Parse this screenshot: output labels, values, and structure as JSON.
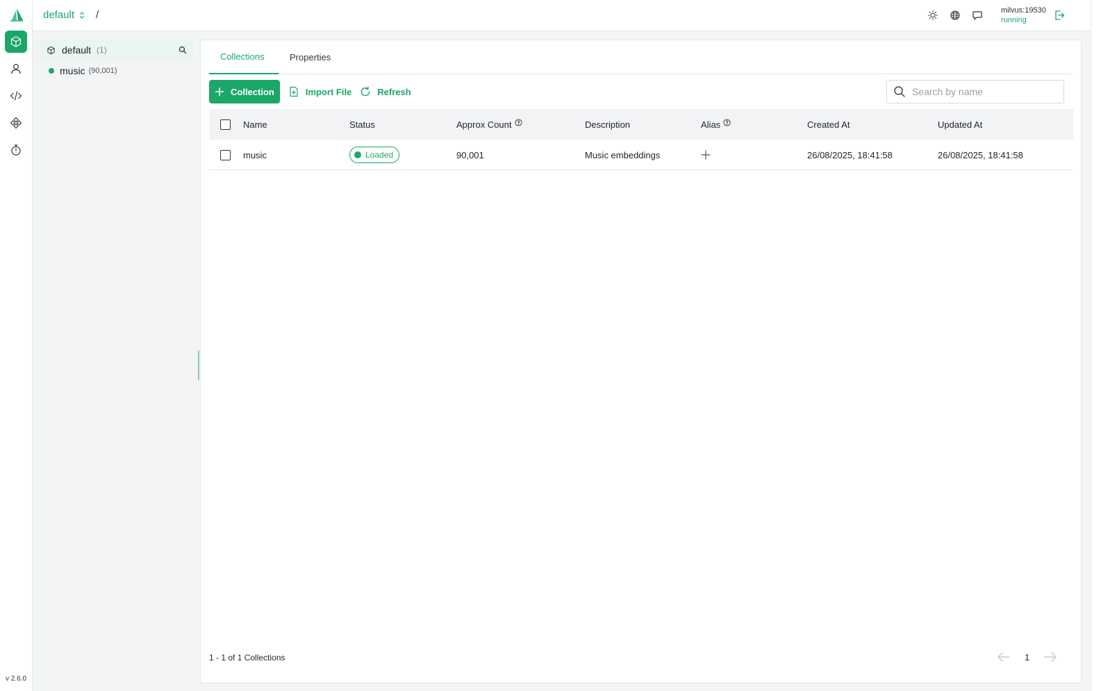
{
  "app": {
    "version": "v 2.6.0",
    "accent_color": "#1aa768"
  },
  "rail": {
    "items": [
      {
        "name": "databases",
        "icon": "cube-icon",
        "active": true
      },
      {
        "name": "users",
        "icon": "user-icon",
        "active": false
      },
      {
        "name": "code",
        "icon": "code-icon",
        "active": false
      },
      {
        "name": "system",
        "icon": "nodes-icon",
        "active": false
      },
      {
        "name": "tasks",
        "icon": "stopwatch-icon",
        "active": false
      }
    ]
  },
  "topbar": {
    "database": "default",
    "separator": "/",
    "connection_address": "milvus:19530",
    "connection_status": "running"
  },
  "tree": {
    "database_label": "default",
    "database_count": "(1)",
    "collections": [
      {
        "name": "music",
        "count": "(90,001)"
      }
    ]
  },
  "tabs": [
    {
      "label": "Collections",
      "active": true
    },
    {
      "label": "Properties",
      "active": false
    }
  ],
  "toolbar": {
    "create_label": "Collection",
    "import_label": "Import File",
    "refresh_label": "Refresh",
    "search_placeholder": "Search by name"
  },
  "table": {
    "columns": [
      "Name",
      "Status",
      "Approx Count",
      "Description",
      "Alias",
      "Created At",
      "Updated At"
    ],
    "rows": [
      {
        "name": "music",
        "status": "Loaded",
        "approx_count": "90,001",
        "description": "Music embeddings",
        "created_at": "26/08/2025, 18:41:58",
        "updated_at": "26/08/2025, 18:41:58"
      }
    ]
  },
  "footer": {
    "summary": "1 - 1 of 1 Collections",
    "current_page": "1"
  }
}
